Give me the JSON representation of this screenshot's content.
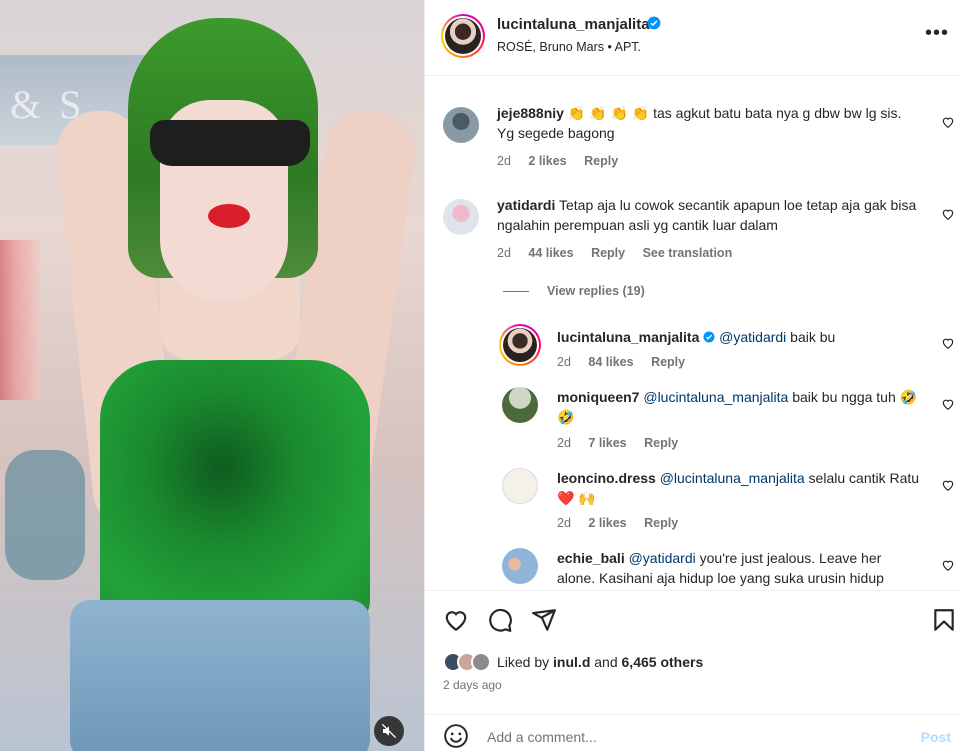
{
  "media": {
    "sign_text": "& S",
    "mute_icon": "speaker-muted-icon"
  },
  "header": {
    "username": "lucintaluna_manjalita",
    "audio": "ROSÉ, Bruno Mars • APT.",
    "more_icon": "more-horizontal-icon"
  },
  "comments": [
    {
      "username": "jeje888niy",
      "text": "👏 👏 👏 👏 tas agkut batu bata nya g dbw bw lg sis. Yg segede bagong",
      "time": "2d",
      "likes": "2 likes",
      "reply": "Reply"
    },
    {
      "username": "yatidardi",
      "text": "Tetap aja lu cowok secantik apapun loe tetap aja gak bisa ngalahin perempuan asli yg cantik luar dalam",
      "time": "2d",
      "likes": "44 likes",
      "reply": "Reply",
      "see_translation": "See translation"
    }
  ],
  "view_replies": "View replies (19)",
  "replies": [
    {
      "username": "lucintaluna_manjalita",
      "mention": "@yatidardi",
      "text": " baik bu",
      "time": "2d",
      "likes": "84 likes",
      "reply": "Reply"
    },
    {
      "username": "moniqueen7",
      "mention": "@lucintaluna_manjalita",
      "text": " baik bu ngga tuh 🤣 🤣",
      "time": "2d",
      "likes": "7 likes",
      "reply": "Reply"
    },
    {
      "username": "leoncino.dress",
      "mention": "@lucintaluna_manjalita",
      "text": " selalu cantik Ratu ❤️ 🙌",
      "time": "2d",
      "likes": "2 likes",
      "reply": "Reply"
    },
    {
      "username": "echie_bali",
      "mention": "@yatidardi",
      "text": " you're just jealous. Leave her alone. Kasihani aja hidup loe yang suka urusin hidup"
    }
  ],
  "likes": {
    "prefix": "Liked by ",
    "user": "inul.d",
    "middle": " and ",
    "others": "6,465 others"
  },
  "date": "2 days ago",
  "add_comment": {
    "placeholder": "Add a comment...",
    "post": "Post"
  },
  "colors": {
    "mention": "#00376b",
    "muted": "#737373",
    "post_disabled": "#b3dbff",
    "verified": "#0095f6"
  }
}
